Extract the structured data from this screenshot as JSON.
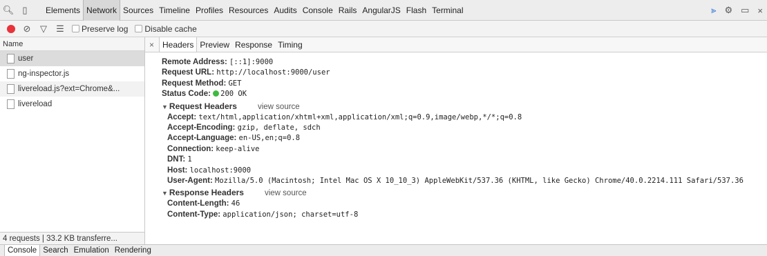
{
  "topbar": {
    "tabs": [
      "Elements",
      "Network",
      "Sources",
      "Timeline",
      "Profiles",
      "Resources",
      "Audits",
      "Console",
      "Rails",
      "AngularJS",
      "Flash",
      "Terminal"
    ],
    "active_tab": "Network"
  },
  "toolbar": {
    "preserve_log": "Preserve log",
    "disable_cache": "Disable cache"
  },
  "requests": {
    "column_name": "Name",
    "items": [
      "user",
      "ng-inspector.js",
      "livereload.js?ext=Chrome&...",
      "livereload"
    ],
    "status": "4 requests | 33.2 KB transferre..."
  },
  "details": {
    "close": "×",
    "tabs": [
      "Headers",
      "Preview",
      "Response",
      "Timing"
    ],
    "general": [
      {
        "key": "Remote Address:",
        "value": "[::1]:9000"
      },
      {
        "key": "Request URL:",
        "value": "http://localhost:9000/user"
      },
      {
        "key": "Request Method:",
        "value": "GET"
      },
      {
        "key": "Status Code:",
        "value": "200 OK"
      }
    ],
    "request_headers_title": "Request Headers",
    "view_source": "view source",
    "request_headers": [
      {
        "key": "Accept:",
        "value": "text/html,application/xhtml+xml,application/xml;q=0.9,image/webp,*/*;q=0.8"
      },
      {
        "key": "Accept-Encoding:",
        "value": "gzip, deflate, sdch"
      },
      {
        "key": "Accept-Language:",
        "value": "en-US,en;q=0.8"
      },
      {
        "key": "Connection:",
        "value": "keep-alive"
      },
      {
        "key": "DNT:",
        "value": "1"
      },
      {
        "key": "Host:",
        "value": "localhost:9000"
      },
      {
        "key": "User-Agent:",
        "value": "Mozilla/5.0 (Macintosh; Intel Mac OS X 10_10_3) AppleWebKit/537.36 (KHTML, like Gecko) Chrome/40.0.2214.111 Safari/537.36"
      }
    ],
    "response_headers_title": "Response Headers",
    "response_headers": [
      {
        "key": "Content-Length:",
        "value": "46"
      },
      {
        "key": "Content-Type:",
        "value": "application/json; charset=utf-8"
      }
    ]
  },
  "drawer": {
    "tabs": [
      "Console",
      "Search",
      "Emulation",
      "Rendering"
    ]
  },
  "colors": {
    "record": "#e8333a",
    "status_ok": "#3fba3f"
  }
}
